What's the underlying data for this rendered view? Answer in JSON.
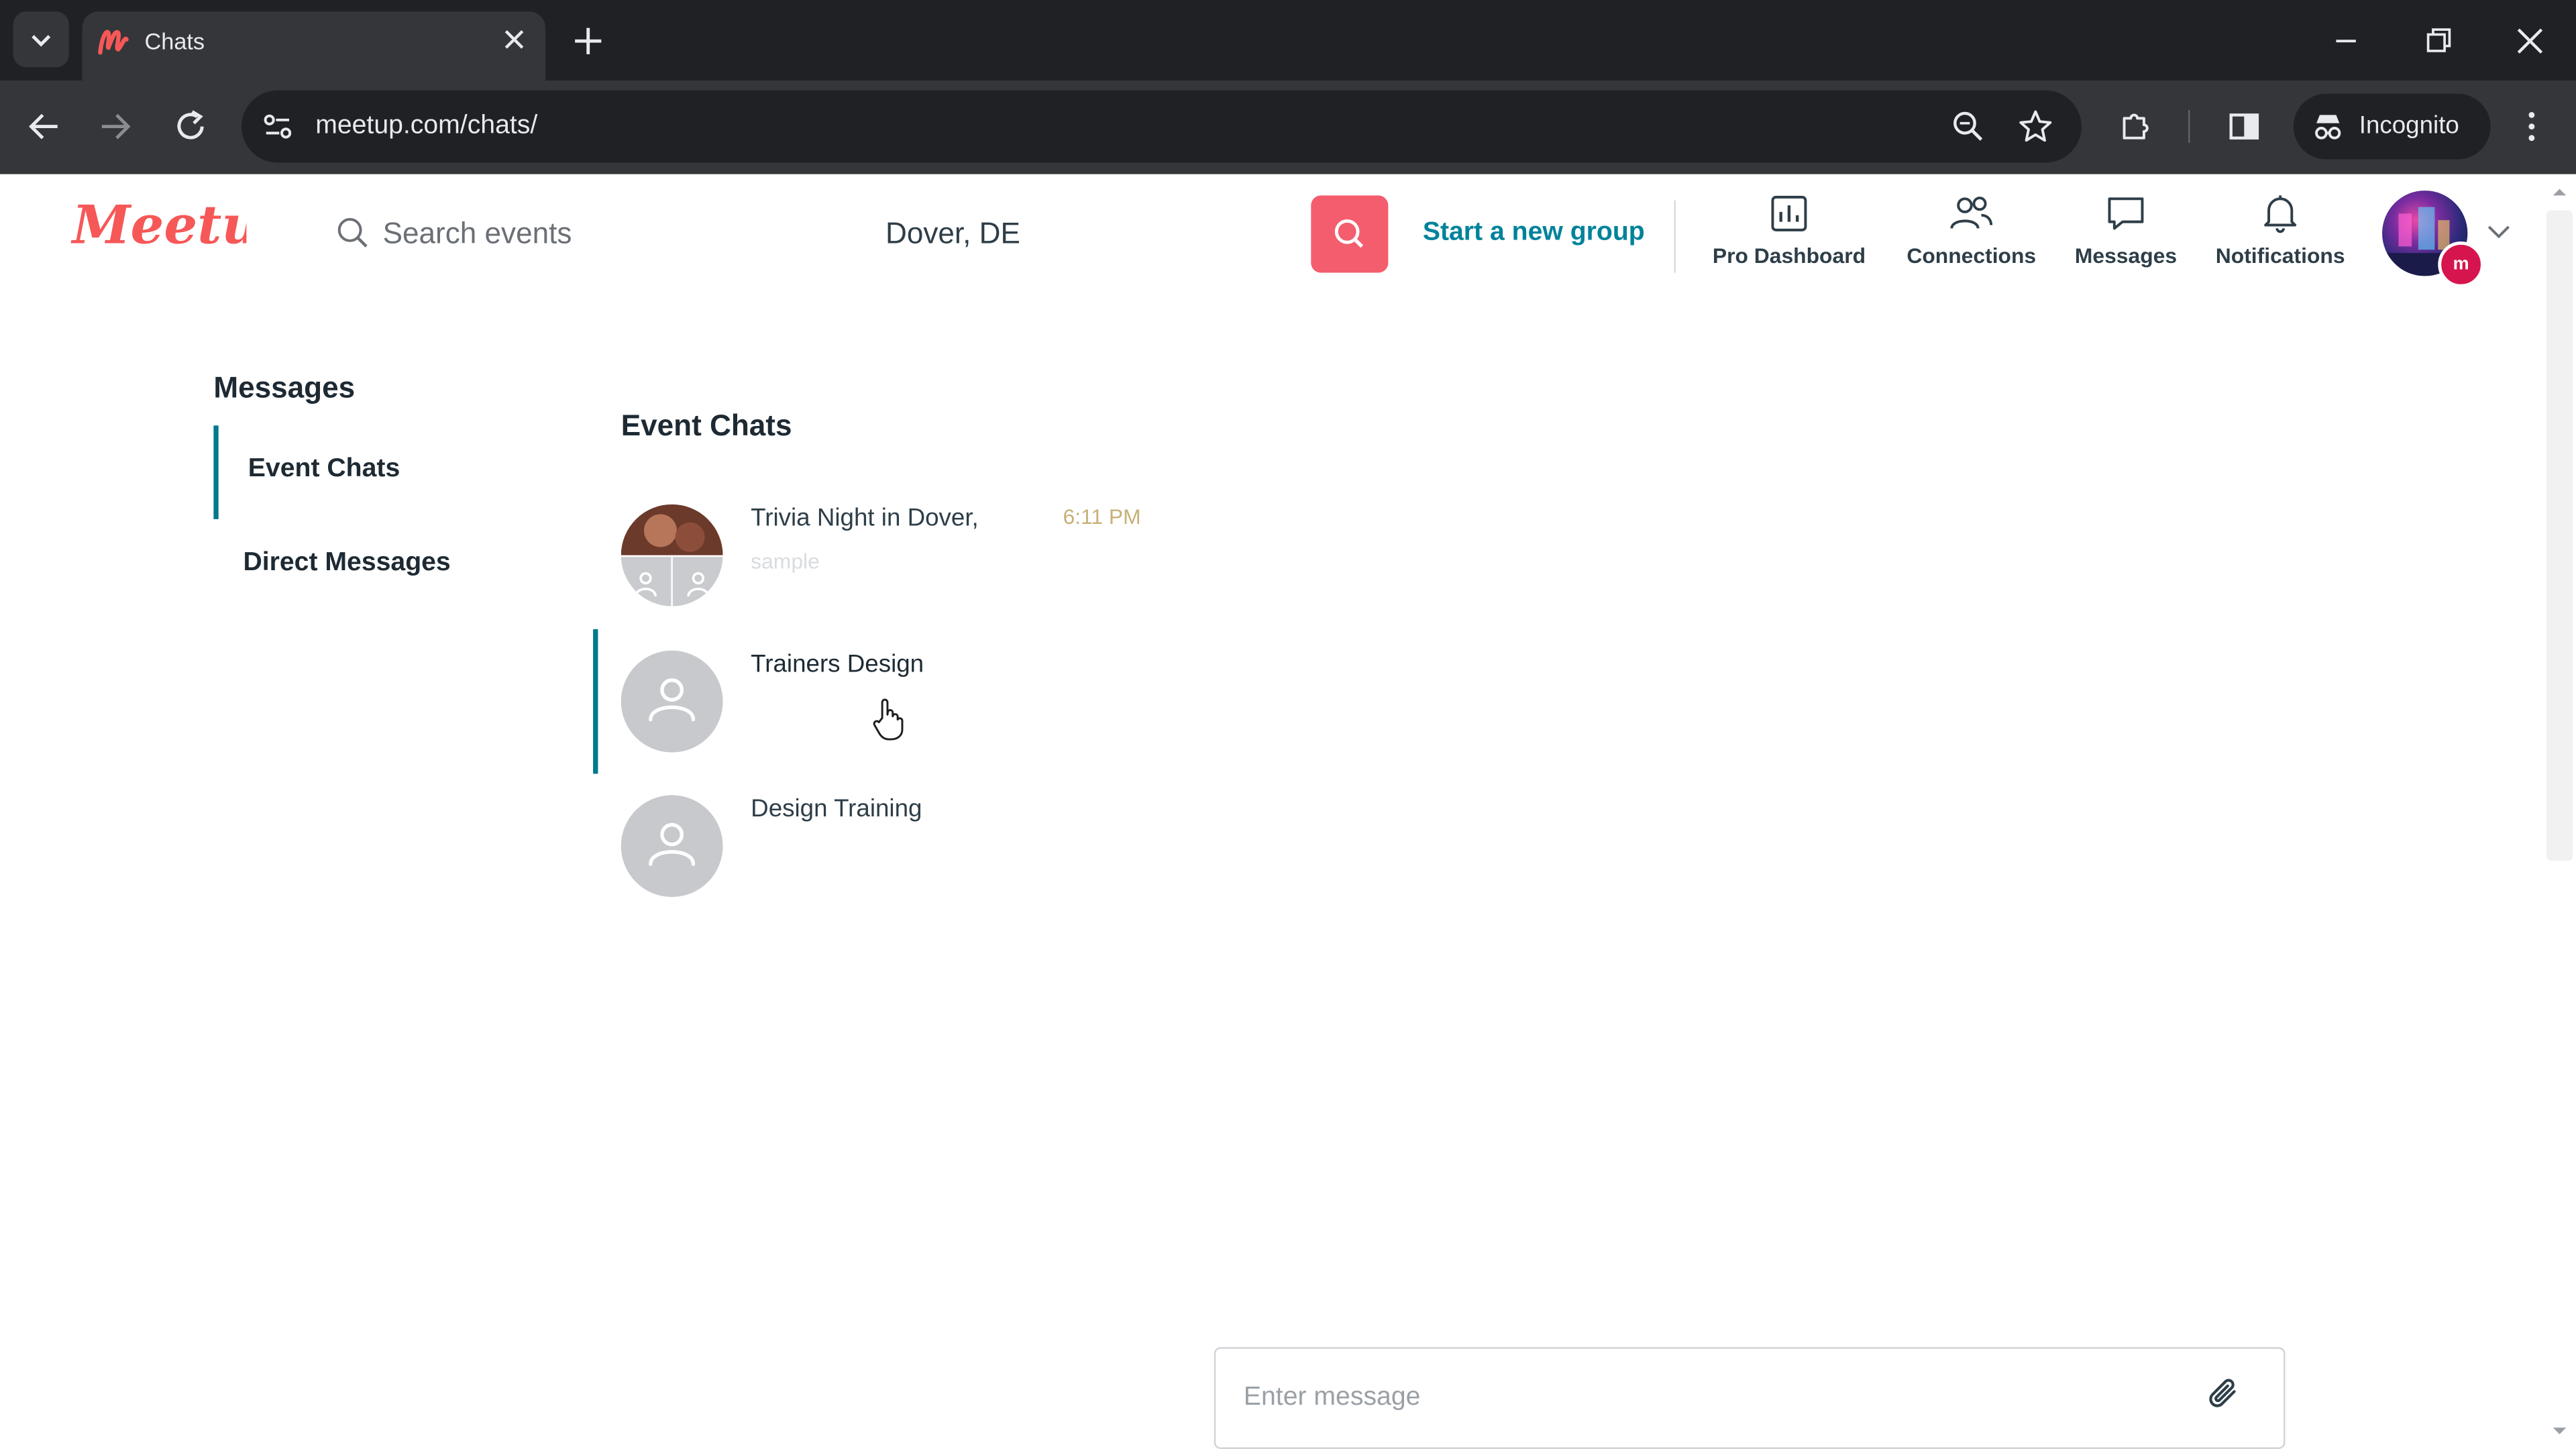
{
  "browser": {
    "tab_title": "Chats",
    "url": "meetup.com/chats/",
    "incognito_label": "Incognito"
  },
  "header": {
    "logo_text": "Meetup",
    "search_placeholder": "Search events",
    "location": "Dover, DE",
    "start_group": "Start a new group",
    "nav": [
      {
        "label": "Pro Dashboard",
        "icon": "bar-chart-icon"
      },
      {
        "label": "Connections",
        "icon": "people-icon"
      },
      {
        "label": "Messages",
        "icon": "chat-bubble-icon"
      },
      {
        "label": "Notifications",
        "icon": "bell-icon"
      }
    ]
  },
  "sidebar": {
    "heading": "Messages",
    "items": [
      {
        "label": "Event Chats",
        "active": true
      },
      {
        "label": "Direct Messages",
        "active": false
      }
    ]
  },
  "chat_list": {
    "heading": "Event Chats",
    "chats": [
      {
        "title": "Trivia Night in Dover,",
        "preview": "sample",
        "time": "6:11 PM"
      },
      {
        "title": "Trainers Design",
        "preview": "",
        "time": "",
        "selected": true
      },
      {
        "title": "Design Training",
        "preview": "",
        "time": ""
      }
    ]
  },
  "composer": {
    "placeholder": "Enter message"
  },
  "colors": {
    "brand": "#f45d6e",
    "accent": "#00798a",
    "link": "#00829b"
  }
}
